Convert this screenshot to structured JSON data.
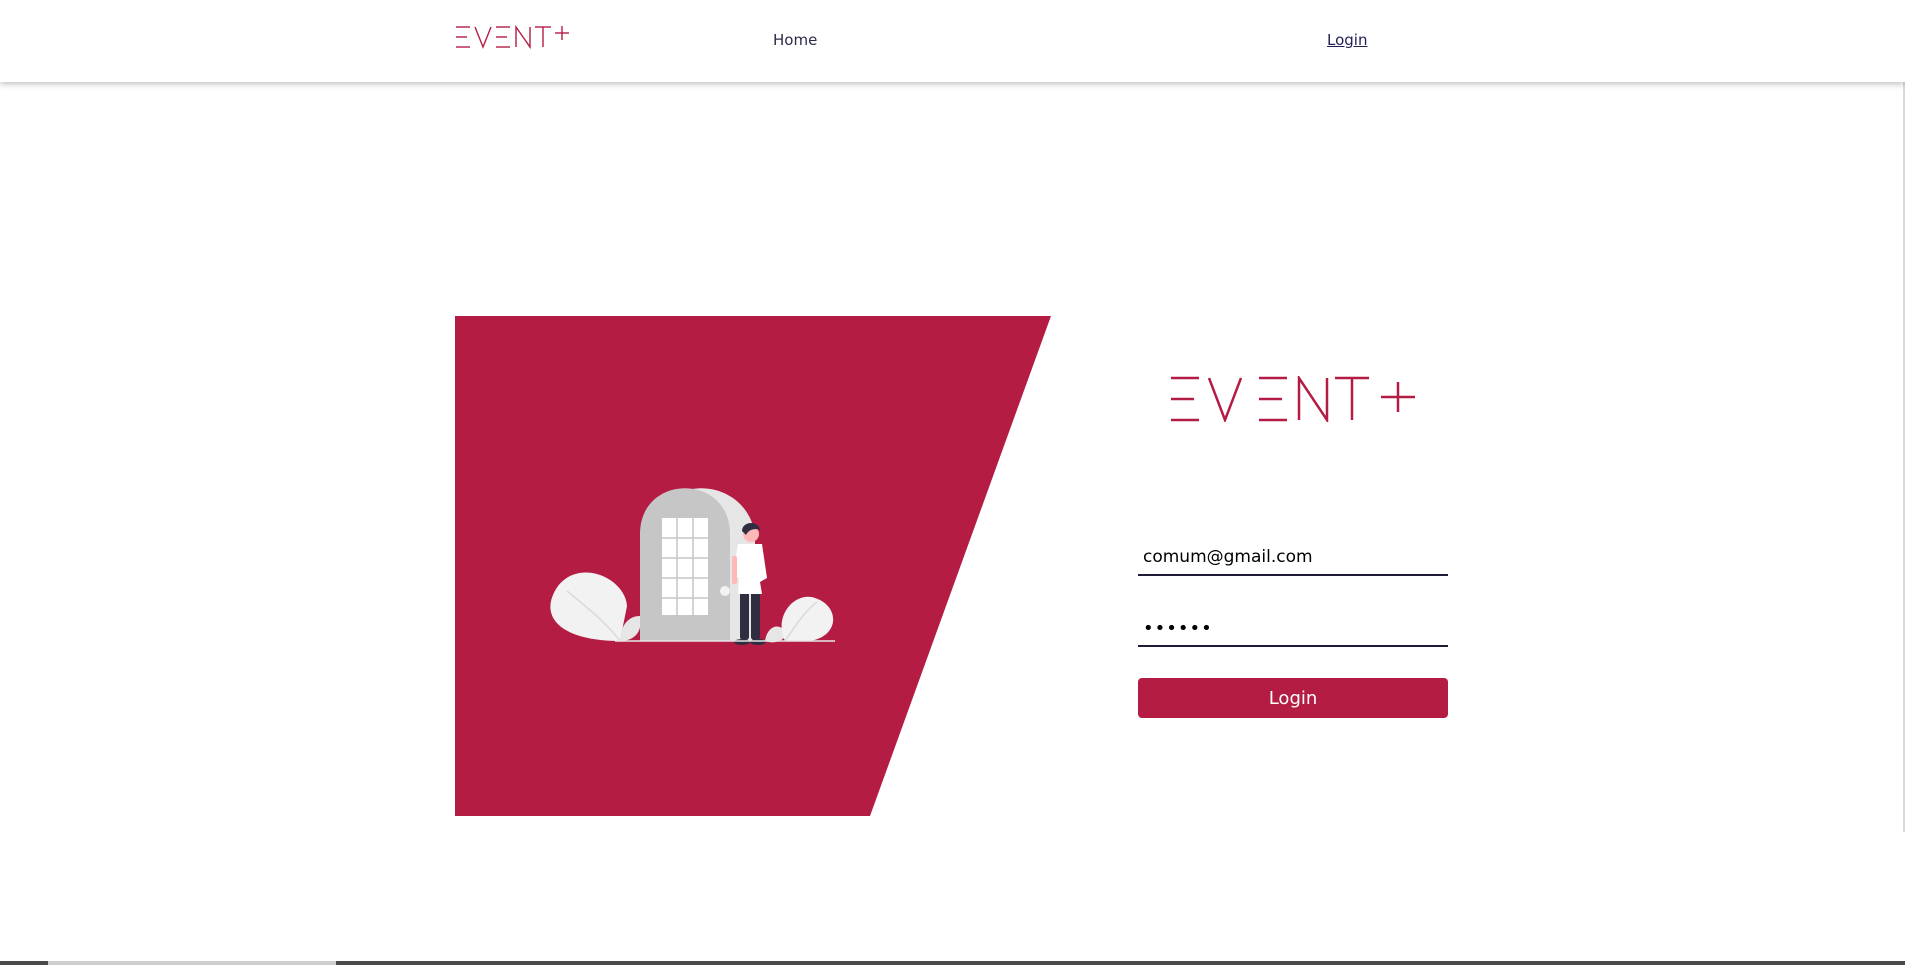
{
  "brand": {
    "name": "EVENT+",
    "color": "#b51c44"
  },
  "header": {
    "nav": {
      "home_label": "Home",
      "login_label": "Login"
    }
  },
  "login_form": {
    "email_value": "comum@gmail.com",
    "password_value": "••••••",
    "submit_label": "Login"
  },
  "icons": [
    "event-plus-logo",
    "door-illustration"
  ],
  "colors": {
    "accent": "#b51c44",
    "text_dark": "#1d1d3a",
    "background": "#ffffff"
  }
}
